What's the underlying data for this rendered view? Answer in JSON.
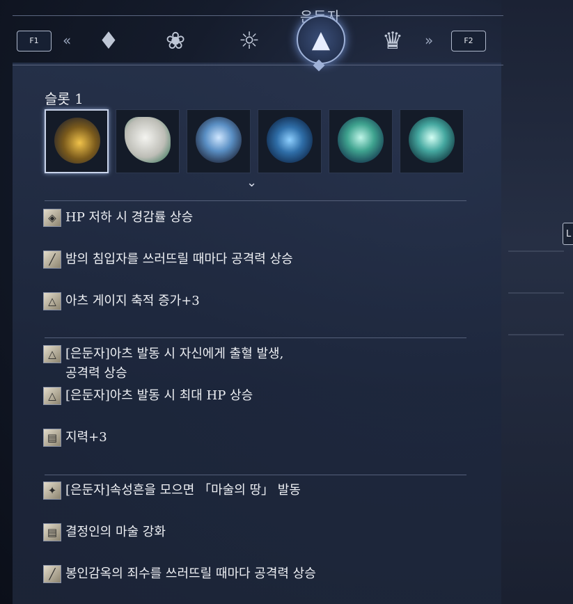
{
  "header": {
    "title": "은둔자",
    "prev_key": "F1",
    "next_key": "F2",
    "prev_arrow": "«",
    "next_arrow": "»",
    "class_icons": [
      "hooded-figure-icon",
      "winged-helm-icon",
      "lion-mane-icon",
      "wizard-hat-icon",
      "knight-helm-icon"
    ],
    "active_index": 3
  },
  "side_key": "L",
  "slots": {
    "title": "슬롯 1",
    "items": [
      {
        "name": "gold-vortex-relic",
        "color": "#b58a2a",
        "selected": true
      },
      {
        "name": "white-bone-relic",
        "color": "#d9d9d4",
        "selected": false
      },
      {
        "name": "blue-orb-relic",
        "color": "#5a8fc4",
        "selected": false
      },
      {
        "name": "blue-thorn-relic",
        "color": "#2f6ea8",
        "selected": false
      },
      {
        "name": "teal-thorn-relic",
        "color": "#3fa38f",
        "selected": false
      },
      {
        "name": "teal-orb-relic",
        "color": "#45a8a0",
        "selected": false
      }
    ]
  },
  "effects": [
    {
      "icon": "shield-icon",
      "text": "HP 저하 시 경감률 상승"
    },
    {
      "icon": "sword-icon",
      "text": "밤의 침입자를 쓰러뜨릴 때마다 공격력 상승"
    },
    {
      "icon": "flask-icon",
      "text": "아츠 게이지 축적 증가+3"
    },
    {
      "icon": "flask-icon",
      "text": "[은둔자]아츠 발동 시 자신에게 출혈 발생,",
      "text2": "공격력 상승"
    },
    {
      "icon": "flask-icon",
      "text": "[은둔자]아츠 발동 시 최대 HP 상승"
    },
    {
      "icon": "scroll-icon",
      "text": "지력+3"
    },
    {
      "icon": "spark-icon",
      "text": "[은둔자]속성흔을 모으면 「마술의 땅」 발동"
    },
    {
      "icon": "scroll-icon",
      "text": "결정인의 마술 강화"
    },
    {
      "icon": "sword-icon",
      "text": "봉인감옥의 죄수를 쓰러뜨릴 때마다 공격력 상승"
    }
  ]
}
